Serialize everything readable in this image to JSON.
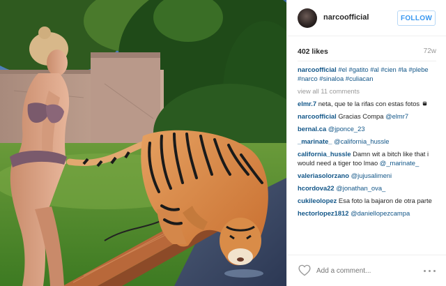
{
  "post": {
    "username": "narcoofficial",
    "follow_label": "FOLLOW",
    "likes": "402 likes",
    "age": "72w"
  },
  "comments": [
    {
      "user": "narcoofficial",
      "text": "#el #gatito #al #cien #la #plebe #narco #sinaloa #culiacan"
    },
    {
      "view_all": "view all 11 comments"
    },
    {
      "user": "elmr.7",
      "text": "neta, que te la rifas con estas fotos"
    },
    {
      "user": "narcoofficial",
      "text": "Gracias Compa",
      "mention": "@elmr7"
    },
    {
      "user": "bernal.ca",
      "mention": "@jponce_23"
    },
    {
      "user": "_marinate_",
      "mention": "@california_hussle"
    },
    {
      "user": "california_hussle",
      "text": "Damn wit a bitch like that i would need a tiger too lmao",
      "mention": "@_marinate_"
    },
    {
      "user": "valeriasolorzano",
      "mention": "@jujusalimeni"
    },
    {
      "user": "hcordova22",
      "mention": "@jonathan_ova_"
    },
    {
      "user": "cukileolopez",
      "text": "Esa foto la bajaron de otra parte"
    },
    {
      "user": "hectorlopez1812",
      "mention": "@daniellopezcampa"
    }
  ],
  "footer": {
    "comment_placeholder": "Add a comment...",
    "heart_icon": "heart-outline-icon",
    "more_icon": "more-options-icon"
  },
  "colors": {
    "link": "#125688",
    "follow_blue": "#3897f0",
    "muted": "#999999"
  }
}
